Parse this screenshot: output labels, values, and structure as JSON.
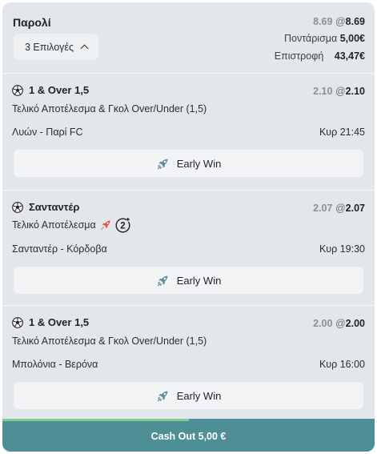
{
  "header": {
    "title": "Παρολί",
    "selections_label": "3 Επιλογές",
    "odds_old": "8.69",
    "odds_at": "@",
    "odds_new": "8.69",
    "stake_label": "Ποντάρισμα",
    "stake_value": "5,00€",
    "return_label": "Επιστροφή",
    "return_value": "43,47€"
  },
  "legs": [
    {
      "selection": "1 & Over 1,5",
      "odds_old": "2.10",
      "odds_new": "2.10",
      "market": "Τελικό Αποτέλεσμα & Γκολ Over/Under (1,5)",
      "match": "Λυών - Παρί FC",
      "time": "Κυρ 21:45",
      "early_win_label": "Early Win",
      "icon": "soccer-ball-icon"
    },
    {
      "selection": "Σανταντέρ",
      "odds_old": "2.07",
      "odds_new": "2.07",
      "market": "Τελικό Αποτέλεσμα",
      "badge": "2",
      "match": "Σανταντέρ - Κόρδοβα",
      "time": "Κυρ 19:30",
      "early_win_label": "Early Win",
      "icon": "soccer-ball-icon"
    },
    {
      "selection": "1 & Over 1,5",
      "odds_old": "2.00",
      "odds_new": "2.00",
      "market": "Τελικό Αποτέλεσμα & Γκολ Over/Under (1,5)",
      "match": "Μπολόνια - Βερόνα",
      "time": "Κυρ 16:00",
      "early_win_label": "Early Win",
      "icon": "soccer-ball-icon"
    }
  ],
  "cashout": {
    "label": "Cash Out 5,00 €",
    "progress": 0.5
  },
  "colors": {
    "card_bg": "#e3e6ea",
    "cashout_bg": "#4e8f95",
    "progress": "#7fce8e",
    "rocket": "#e0553f"
  }
}
